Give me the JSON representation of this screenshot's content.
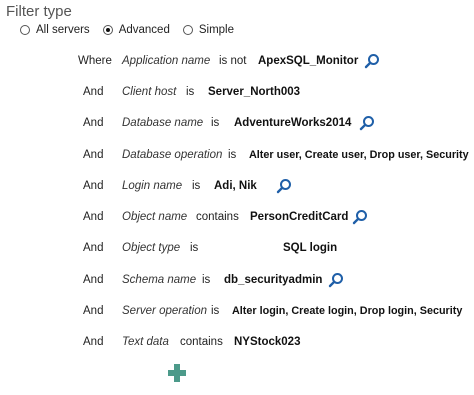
{
  "filter": {
    "title": "Filter type",
    "options": [
      {
        "label": "All servers",
        "checked": false
      },
      {
        "label": "Advanced",
        "checked": true
      },
      {
        "label": "Simple",
        "checked": false
      }
    ]
  },
  "conditions": [
    {
      "conj": "Where",
      "field": "Application name",
      "op": "is not",
      "value": "ApexSQL_Monitor",
      "has_search": true
    },
    {
      "conj": "And",
      "field": "Client host",
      "op": "is",
      "value": "Server_North003",
      "has_search": false
    },
    {
      "conj": "And",
      "field": "Database name",
      "op": "is",
      "value": "AdventureWorks2014",
      "has_search": true
    },
    {
      "conj": "And",
      "field": "Database operation",
      "op": "is",
      "value": "Alter user, Create user, Drop user, Security",
      "has_search": false
    },
    {
      "conj": "And",
      "field": "Login name",
      "op": "is",
      "value": "Adi, Nik",
      "has_search": true
    },
    {
      "conj": "And",
      "field": "Object name",
      "op": "contains",
      "value": "PersonCreditCard",
      "has_search": true
    },
    {
      "conj": "And",
      "field": "Object type",
      "op": "is",
      "value": "SQL login",
      "has_search": false
    },
    {
      "conj": "And",
      "field": "Schema name",
      "op": "is",
      "value": "db_securityadmin",
      "has_search": true
    },
    {
      "conj": "And",
      "field": "Server operation",
      "op": "is",
      "value": "Alter login, Create login, Drop login, Security",
      "has_search": false
    },
    {
      "conj": "And",
      "field": "Text data",
      "op": "contains",
      "value": "NYStock023",
      "has_search": false
    }
  ],
  "icons": {
    "search": "search-icon",
    "add": "plus-icon"
  },
  "colors": {
    "search_icon": "#1f5fa8",
    "add_icon": "#4c9a8a"
  }
}
